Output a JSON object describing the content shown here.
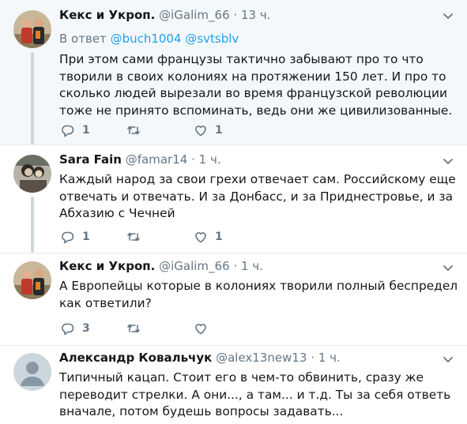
{
  "tweets": [
    {
      "name": "Кекс и Укроп.",
      "handle": "@iGalim_66",
      "dot": "·",
      "time": "13 ч.",
      "reply_prefix": "В ответ",
      "reply_mentions": [
        "@buch1004",
        "@svtsblv"
      ],
      "lines": [
        "При этом сами французы тактично забывают про то что",
        "творили в своих колониях на протяжении 150 лет. И про то",
        "сколько людей вырезали во время французской революции",
        "тоже не принято вспоминать, ведь они же цивилизованные."
      ],
      "reply_count": "1",
      "retweet_count": "",
      "like_count": "1"
    },
    {
      "name": "Sara Fain",
      "handle": "@famar14",
      "dot": "·",
      "time": "1 ч.",
      "lines": [
        "Каждый народ за свои грехи отвечает сам. Российскому еще",
        "отвечать и отвечать. И за Донбасс, и за Приднестровье, и за",
        "Абхазию с Чечней"
      ],
      "reply_count": "1",
      "retweet_count": "",
      "like_count": "1"
    },
    {
      "name": "Кекс и Укроп.",
      "handle": "@iGalim_66",
      "dot": "·",
      "time": "1 ч.",
      "lines": [
        "А Европейцы которые в колониях творили полный беспредел",
        "как ответили?"
      ],
      "reply_count": "3",
      "retweet_count": "",
      "like_count": ""
    },
    {
      "name": "Александр Ковальчук",
      "handle": "@alex13new13",
      "dot": "·",
      "time": "1 ч.",
      "lines": [
        "Типичный кацап. Стоит его в чем-то обвинить, сразу же",
        "переводит стрелки. А они..., а там... и т.д. Ты за себя ответь",
        "вначале, потом будешь вопросы задавать..."
      ]
    }
  ],
  "icons": {
    "reply": "reply-icon",
    "retweet": "retweet-icon",
    "like": "like-icon",
    "caret": "chevron-down-icon"
  },
  "colors": {
    "link": "#1da1f2",
    "secondary": "#657786",
    "thread_line": "#ccd6dd",
    "highlight_bg": "#f5f8fa"
  }
}
